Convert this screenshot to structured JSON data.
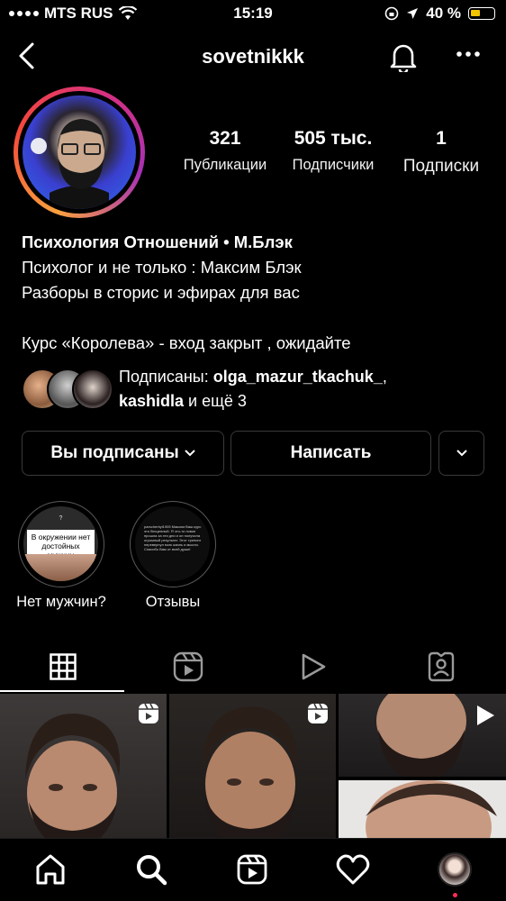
{
  "status_bar": {
    "carrier": "MTS RUS",
    "time": "15:19",
    "battery": "40 %"
  },
  "header": {
    "username": "sovetnikkk"
  },
  "stats": [
    {
      "value": "321",
      "label": "Публикации"
    },
    {
      "value": "505 тыс.",
      "label": "Подписчики"
    },
    {
      "value": "1",
      "label": "Подписки"
    }
  ],
  "bio": {
    "name": "Психология Отношений • М.Блэк",
    "lines": [
      "Психолог и не только : Максим Блэк",
      "Разборы в сторис и эфирах для вас",
      "",
      "Курс «Королева» - вход закрыт , ожидайте"
    ]
  },
  "followed_by": {
    "prefix": "Подписаны: ",
    "user1": "olga_mazur_tkachuk_",
    "sep": ",",
    "user2": "kashidla",
    "suffix": " и ещё 3"
  },
  "buttons": {
    "following": "Вы подписаны",
    "message": "Написать"
  },
  "highlights": [
    {
      "label": "Нет мужчин?",
      "cover_q": "?",
      "cover_text": "В окружении нет достойных мужчин"
    },
    {
      "label": "Отзывы",
      "cover_text": "parscherbyl1905 Максим Ваш курс это бесценный. Я что-то новое прошла за эти дни и он получила огромный результат. Этот тренинг перевернул мою жизнь и мысли. Спасибо Вам от всей души!"
    }
  ],
  "tabs": [
    "grid",
    "reels",
    "videos",
    "tagged"
  ],
  "colors": {
    "accent_ring": "#d8317e",
    "battery": "#f5c400"
  }
}
